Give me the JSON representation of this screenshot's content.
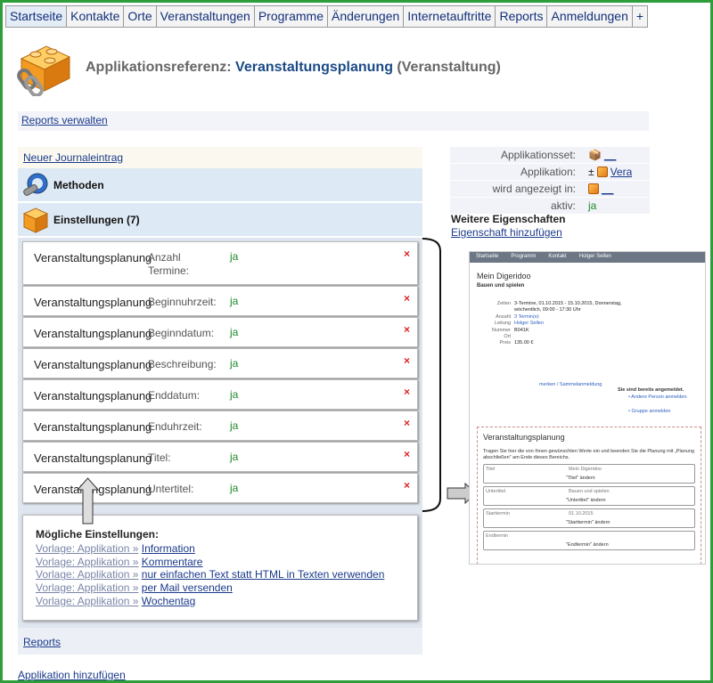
{
  "nav": {
    "tabs": [
      "Startseite",
      "Kontakte",
      "Orte",
      "Veranstaltungen",
      "Programme",
      "Änderungen",
      "Internetauftritte",
      "Reports",
      "Anmeldungen",
      "+"
    ]
  },
  "header": {
    "title_prefix": "Applikationsreferenz:",
    "title_main": "Veranstaltungsplanung",
    "title_suffix": "(Veranstaltung)"
  },
  "reports_link": "Reports verwalten",
  "journal_link": "Neuer Journaleintrag",
  "sections": {
    "methods": "Methoden",
    "settings": "Einstellungen (7)"
  },
  "settings": [
    {
      "name": "Veranstaltungsplanung",
      "prop": "Anzahl Termine:",
      "value": "ja"
    },
    {
      "name": "Veranstaltungsplanung",
      "prop": "Beginnuhrzeit:",
      "value": "ja"
    },
    {
      "name": "Veranstaltungsplanung",
      "prop": "Beginndatum:",
      "value": "ja"
    },
    {
      "name": "Veranstaltungsplanung",
      "prop": "Beschreibung:",
      "value": "ja"
    },
    {
      "name": "Veranstaltungsplanung",
      "prop": "Enddatum:",
      "value": "ja"
    },
    {
      "name": "Veranstaltungsplanung",
      "prop": "Enduhrzeit:",
      "value": "ja"
    },
    {
      "name": "Veranstaltungsplanung",
      "prop": "Titel:",
      "value": "ja"
    },
    {
      "name": "Veranstaltungsplanung",
      "prop": "Untertitel:",
      "value": "ja"
    }
  ],
  "delete_glyph": "×",
  "possible": {
    "title": "Mögliche Einstellungen:",
    "prefix": "Vorlage: Applikation »",
    "items": [
      "Information",
      "Kommentare",
      "nur einfachen Text statt HTML in Texten verwenden",
      "per Mail versenden",
      "Wochentag"
    ]
  },
  "reports_footer": "Reports",
  "add_application": "Applikation hinzufügen",
  "properties": [
    {
      "label": "Applikationsset:",
      "value": "__"
    },
    {
      "label": "Applikation:",
      "value": "Veranstaltungsplanung",
      "prefix": "±"
    },
    {
      "label": "wird angezeigt in:",
      "value": "__"
    },
    {
      "label": "aktiv:",
      "value": "ja"
    }
  ],
  "more_properties": "Weitere Eigenschaften",
  "add_property": "Eigenschaft hinzufügen",
  "preview": {
    "nav": [
      "Startseite",
      "Programm",
      "Kontakt",
      "Holger Sellen"
    ],
    "title": "Mein Digeridoo",
    "subtitle": "Bauen und spielen",
    "details": [
      {
        "k": "Zeiten",
        "v": "3-Termine, 01.10.2015 - 15.10.2015, Donnerstag, wöchentlich, 09:00 - 17:30 Uhr"
      },
      {
        "k": "Anzahl",
        "v": "3 Termin(e)",
        "link": true
      },
      {
        "k": "Leitung",
        "v": "Holger Sellen",
        "link": true
      },
      {
        "k": "Nummer",
        "v": "B041K"
      },
      {
        "k": "Ort",
        "v": ""
      },
      {
        "k": "Preis",
        "v": "135.00 €"
      }
    ],
    "remember": "merken / Sammelanmeldung",
    "registered": "Sie sind bereits angemeldet.",
    "other_person": "• Andere Person anmelden",
    "group": "• Gruppe anmelden",
    "box_title": "Veranstaltungsplanung",
    "box_text": "Tragen Sie hier die von Ihnen gewünschten Werte ein und beenden Sie die Planung mit „Planung abschließen\" am Ende dieses Bereichs.",
    "fields": [
      {
        "label": "Titel",
        "value": "Mein Digeridoo",
        "action": "\"Titel\" ändern"
      },
      {
        "label": "Untertitel",
        "value": "Bauen und spielen",
        "action": "\"Untertitel\" ändern"
      },
      {
        "label": "Starttermin",
        "value": "01.10.2015",
        "action": "\"Starttermin\" ändern"
      },
      {
        "label": "Endtermin",
        "value": "",
        "action": "\"Endtermin\" ändern"
      }
    ]
  }
}
